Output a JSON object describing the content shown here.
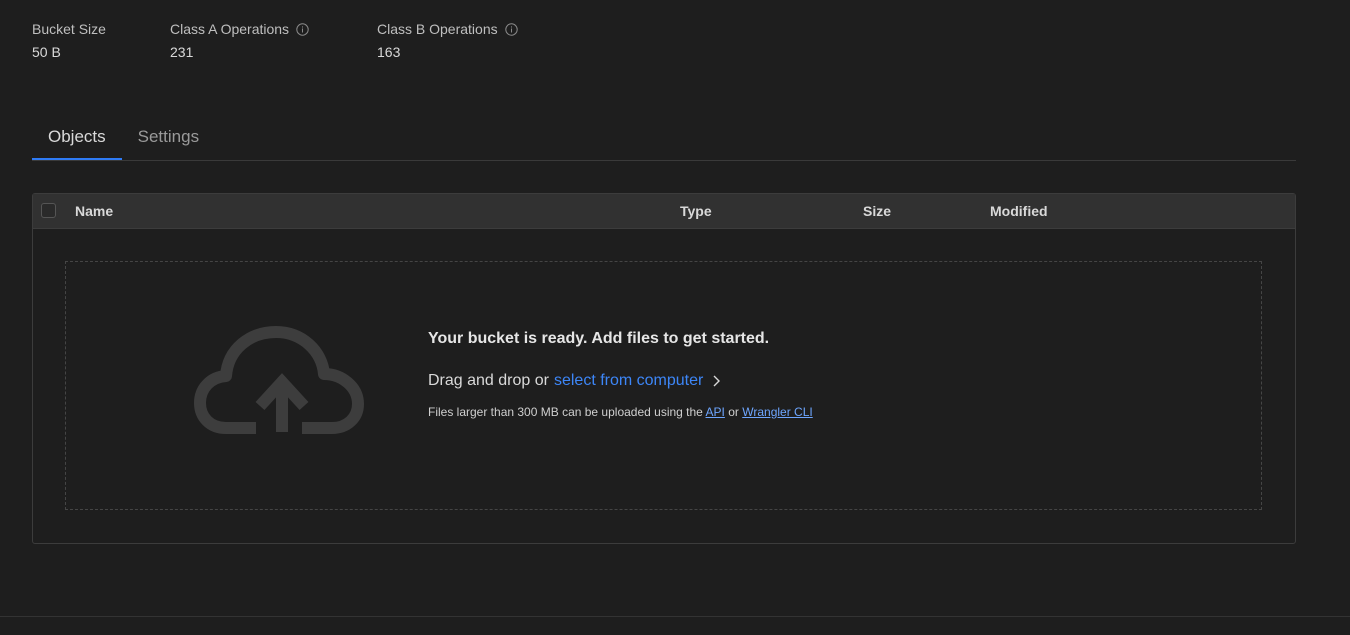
{
  "metrics": [
    {
      "label": "Bucket Size",
      "value": "50 B"
    },
    {
      "label": "Class A Operations",
      "value": "231",
      "icon": "info-icon"
    },
    {
      "label": "Class B Operations",
      "value": "163",
      "icon": "info-icon"
    }
  ],
  "tabs": [
    {
      "label": "Objects",
      "active": true
    },
    {
      "label": "Settings",
      "active": false
    }
  ],
  "table": {
    "columns": [
      "Name",
      "Type",
      "Size",
      "Modified"
    ]
  },
  "empty_state": {
    "title": "Your bucket is ready. Add files to get started.",
    "drag_text": "Drag and drop or",
    "select_link": "select from computer",
    "note_prefix": "Files larger than 300 MB can be uploaded using the",
    "api_link": "API",
    "note_or": "or",
    "cli_link": "Wrangler CLI",
    "icon": "cloud-upload-icon"
  },
  "colors": {
    "background": "#1e1e1e",
    "accent": "#2f7bf5",
    "link": "#3d86f7",
    "header_bg": "#313131"
  }
}
